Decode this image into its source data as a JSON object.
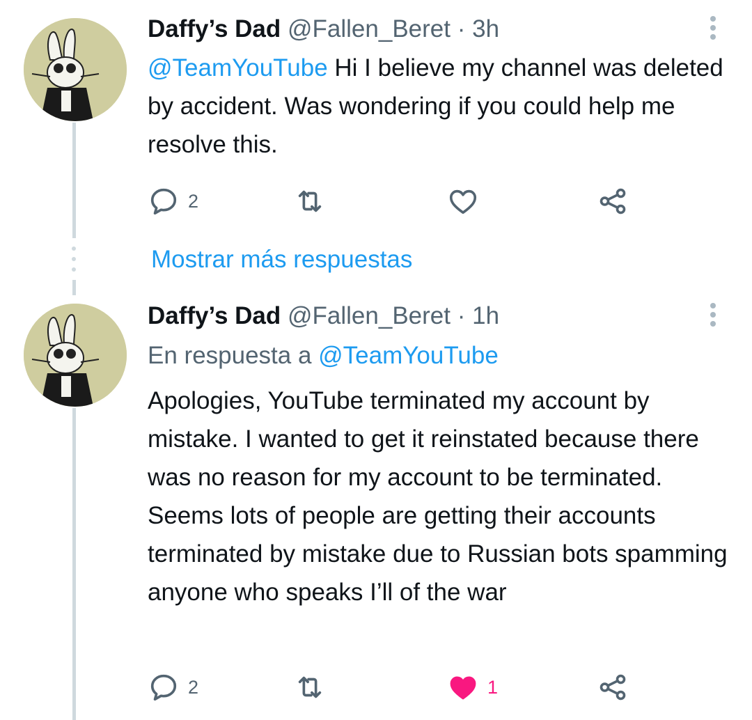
{
  "tweets": [
    {
      "author": {
        "name": "Daffy’s Dad",
        "handle": "@Fallen_Beret"
      },
      "separator": "·",
      "time": "3h",
      "body": {
        "mention": "@TeamYouTube",
        "text": " Hi I believe my channel was deleted by accident. Was wondering if you could help me resolve this."
      },
      "actions": {
        "reply_count": "2",
        "retweet_count": "",
        "like_count": "",
        "liked": false
      }
    },
    {
      "author": {
        "name": "Daffy’s Dad",
        "handle": "@Fallen_Beret"
      },
      "separator": "·",
      "time": "1h",
      "reply_to": {
        "prefix": "En respuesta a ",
        "mention": "@TeamYouTube"
      },
      "body": {
        "text": "Apologies, YouTube terminated my account by mistake. I wanted to get it reinstated because there was no reason for my account to be terminated. Seems lots of people are getting their accounts terminated by mistake due to Russian bots spamming anyone who speaks I’ll of the war"
      },
      "actions": {
        "reply_count": "2",
        "retweet_count": "",
        "like_count": "1",
        "liked": true
      }
    }
  ],
  "thread": {
    "show_more_label": "Mostrar más respuestas"
  },
  "colors": {
    "link": "#1d9bf0",
    "secondary_text": "#536471",
    "like_active": "#f91880",
    "thread_line": "#cfd9de",
    "avatar_bg": "#cfcd9f"
  },
  "icons": {
    "reply": "reply-icon",
    "retweet": "retweet-icon",
    "like": "heart-icon",
    "share": "share-icon",
    "more": "more-vertical-icon"
  }
}
